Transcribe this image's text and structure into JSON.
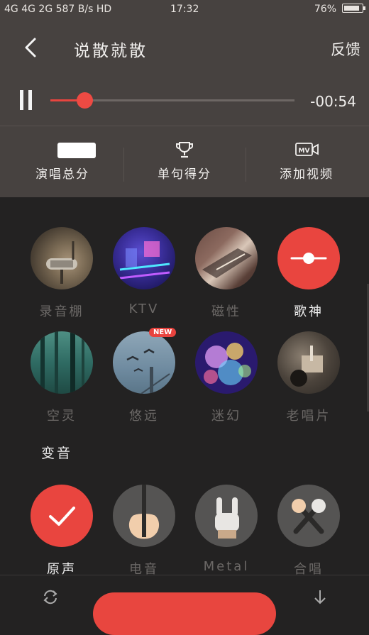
{
  "status_bar": {
    "left": "4G 4G 2G 587 B/s HD",
    "time": "17:32",
    "battery": "76%"
  },
  "header": {
    "title": "说散就散",
    "feedback_label": "反馈"
  },
  "player": {
    "remaining_time": "-00:54",
    "progress_fraction": 0.14
  },
  "score_row": [
    {
      "label": "演唱总分",
      "icon": "score-box"
    },
    {
      "label": "单句得分",
      "icon": "trophy-icon"
    },
    {
      "label": "添加视频",
      "icon": "mv-icon"
    }
  ],
  "effects": [
    {
      "label": "录音棚",
      "icon": "studio-microphone-photo"
    },
    {
      "label": "KTV",
      "icon": "ktv-room-photo"
    },
    {
      "label": "磁性",
      "icon": "piano-photo"
    },
    {
      "label": "歌神",
      "icon": "slider-icon",
      "selected": true
    },
    {
      "label": "空灵",
      "icon": "forest-photo"
    },
    {
      "label": "悠远",
      "icon": "birds-bridge-photo",
      "badge": "NEW"
    },
    {
      "label": "迷幻",
      "icon": "bokeh-lights-photo"
    },
    {
      "label": "老唱片",
      "icon": "record-player-photo"
    }
  ],
  "voice_section": {
    "title": "变音",
    "items": [
      {
        "label": "原声",
        "icon": "check-icon",
        "selected": true
      },
      {
        "label": "电音",
        "icon": "guitar-icon"
      },
      {
        "label": "Metal",
        "icon": "rock-hand-icon"
      },
      {
        "label": "合唱",
        "icon": "microphones-icon"
      }
    ]
  },
  "colors": {
    "accent": "#e8463f",
    "header_bg": "#474240",
    "panel_bg": "#232222"
  }
}
